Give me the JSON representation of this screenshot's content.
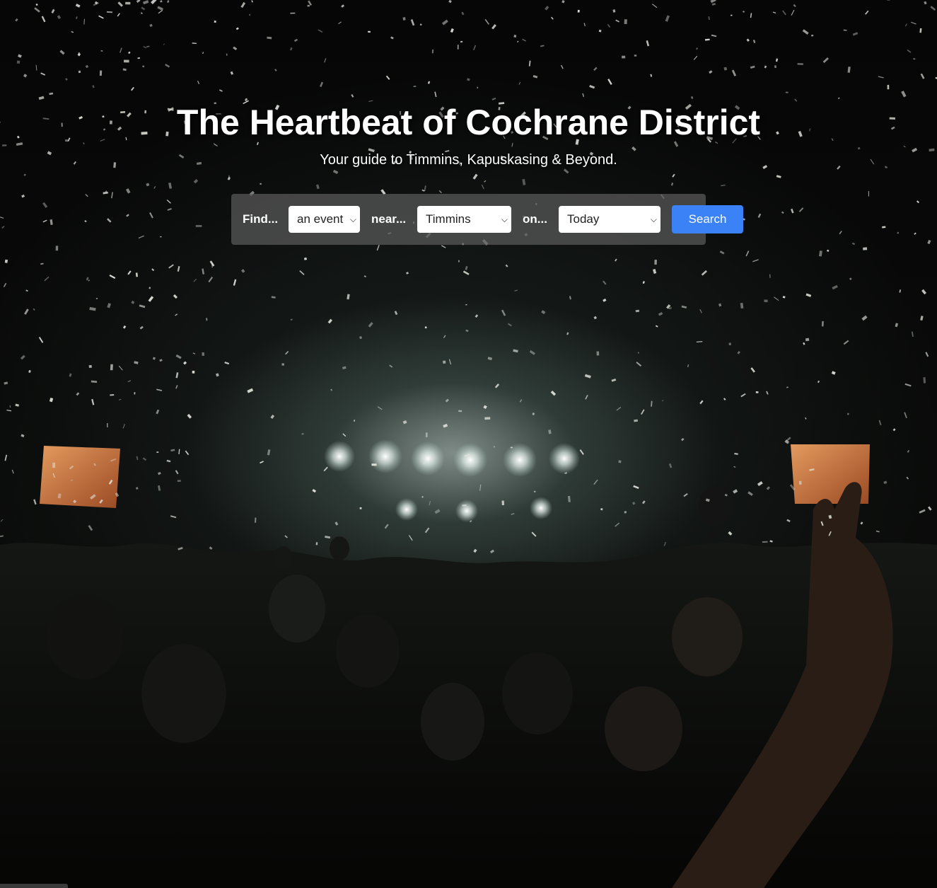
{
  "hero": {
    "title": "The Heartbeat of Cochrane District",
    "subtitle": "Your guide to Timmins, Kapuskasing & Beyond."
  },
  "search": {
    "find_label": "Find...",
    "what_value": "an event",
    "near_label": "near...",
    "where_value": "Timmins",
    "on_label": "on...",
    "when_value": "Today",
    "button_label": "Search"
  },
  "colors": {
    "accent": "#3b82f6",
    "panel": "#5a5a5a",
    "text": "#ffffff"
  },
  "icons": {
    "dropdown": "chevron-down-icon"
  }
}
